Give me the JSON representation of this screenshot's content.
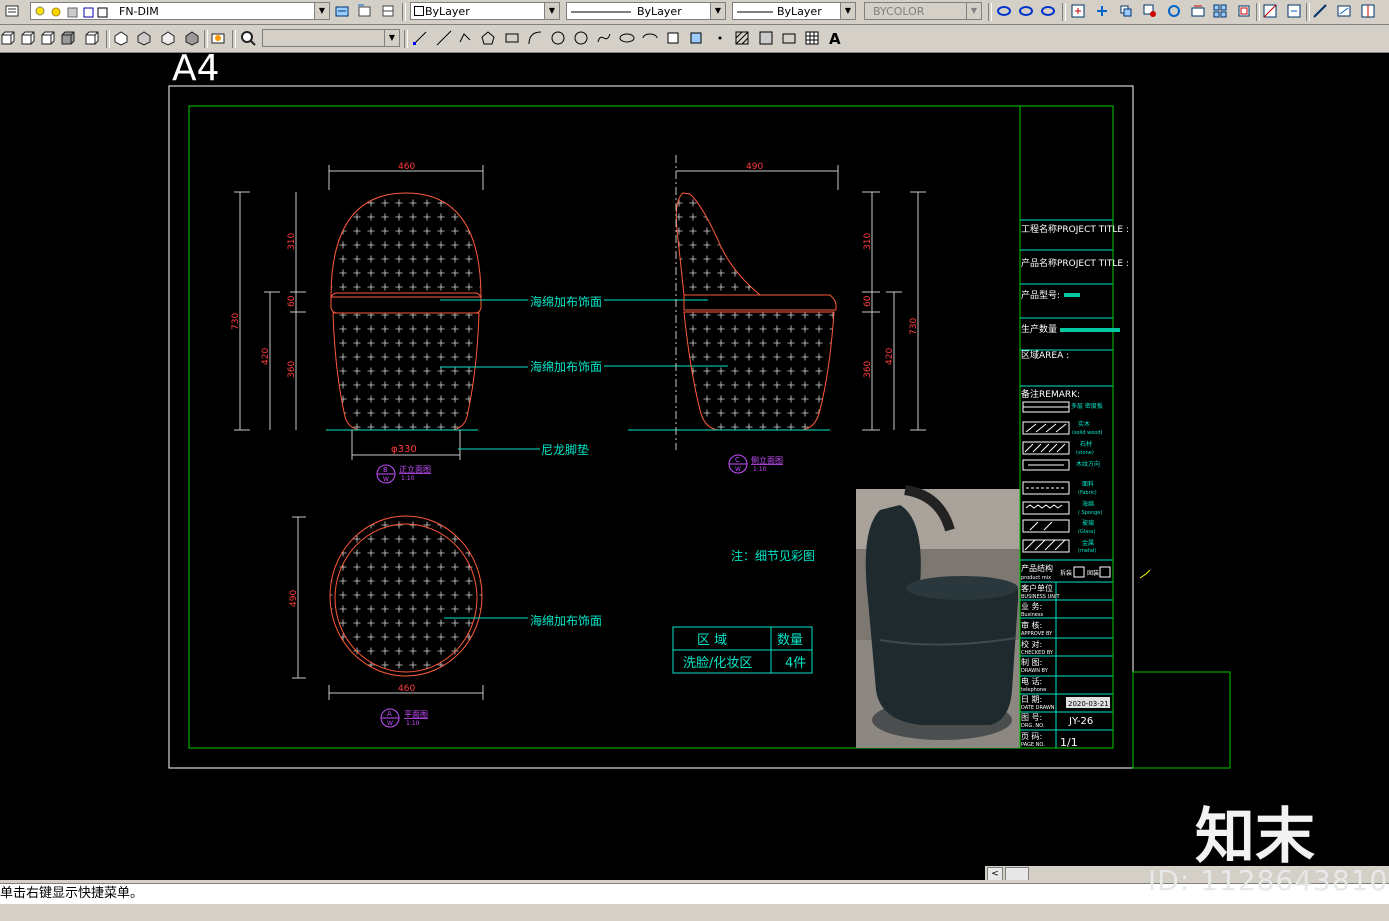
{
  "toolbar": {
    "layer_name": "FN-DIM",
    "color": "ByLayer",
    "linetype": "ByLayer",
    "lineweight": "ByLayer",
    "plotstyle": "BYCOLOR",
    "second_combo": ""
  },
  "sheet": {
    "size_label": "A4"
  },
  "dims": {
    "front_width_top": "460",
    "side_width_top": "490",
    "front_left_outer": "730",
    "front_left_inner": "420",
    "front_seg_310": "310",
    "front_seg_60": "60",
    "front_seg_360": "360",
    "base_diameter": "φ330",
    "side_seg_310": "310",
    "side_seg_60": "60",
    "side_seg_360": "360",
    "side_right_inner": "420",
    "side_right_outer": "730",
    "plan_height": "490",
    "plan_width": "460"
  },
  "labels": {
    "fabric_1": "海绵加布饰面",
    "fabric_2": "海绵加布饰面",
    "nylon_pad": "尼龙脚垫",
    "fabric_plan": "海绵加布饰面",
    "note": "注：细节见彩图"
  },
  "views": {
    "front": {
      "letter": "B",
      "sub": "W",
      "title": "正立面图",
      "scale": "1:10"
    },
    "side": {
      "letter": "C",
      "sub": "W",
      "title": "侧立面图",
      "scale": "1:10"
    },
    "plan": {
      "letter": "A",
      "sub": "W",
      "title": "平面图",
      "scale": "1:10"
    }
  },
  "qty_table": {
    "headers": [
      "区  域",
      "数量"
    ],
    "row": [
      "洗脸/化妆区",
      "4件"
    ]
  },
  "title_block": {
    "project_title": "工程名称PROJECT TITLE :",
    "product_title": "产品名称PROJECT TITLE :",
    "product_model": "产品型号:",
    "product_qty": "生产数量",
    "area": "区域AREA :",
    "remark": "备注REMARK:",
    "legend": [
      {
        "cn": "多层  密度板",
        "en": ""
      },
      {
        "cn": "实木",
        "en": "(solid wood)"
      },
      {
        "cn": "石材",
        "en": "(stone)"
      },
      {
        "cn": "木纹方向",
        "en": ""
      },
      {
        "cn": "面料",
        "en": "(Fabric)"
      },
      {
        "cn": "海绵",
        "en": "( Sponge)"
      },
      {
        "cn": "玻璃",
        "en": "(Glass)"
      },
      {
        "cn": "金属",
        "en": "(metal)"
      }
    ],
    "product_structure": "产品结构",
    "product_structure_en": "product mix",
    "opt_a": "拆装",
    "opt_b": "固装",
    "client": "客户单位",
    "client_en": "BUSINESS UNIT",
    "business": "业  务:",
    "business_en": "Business",
    "approve": "审  核:",
    "approve_en": "APPROVE BY",
    "check": "校  对:",
    "check_en": "CHECKED BY",
    "drawn": "制  图:",
    "drawn_en": "DRAWN BY",
    "phone": "电  话:",
    "phone_en": "telephone",
    "date": "日  期:",
    "date_en": "DATE DRAWN",
    "date_value": "2020-03-21",
    "drawing_no": "图  号:",
    "drawing_no_en": "DRG. NO.",
    "drawing_no_value": "JY-26",
    "page": "页  码:",
    "page_en": "PAGE  NO.",
    "page_value": "1/1"
  },
  "watermark": {
    "logo": "知末",
    "id": "ID: 1128643810"
  },
  "command_line": "单击右键显示快捷菜单。",
  "colors": {
    "frame_green": "#00c800",
    "cyan": "#00e6c8",
    "red_outline": "#ff5a3c",
    "dim_gray": "#c8c8c8",
    "dim_red_text": "#ff3c3c",
    "magenta": "#c850ff",
    "white": "#ffffff"
  }
}
